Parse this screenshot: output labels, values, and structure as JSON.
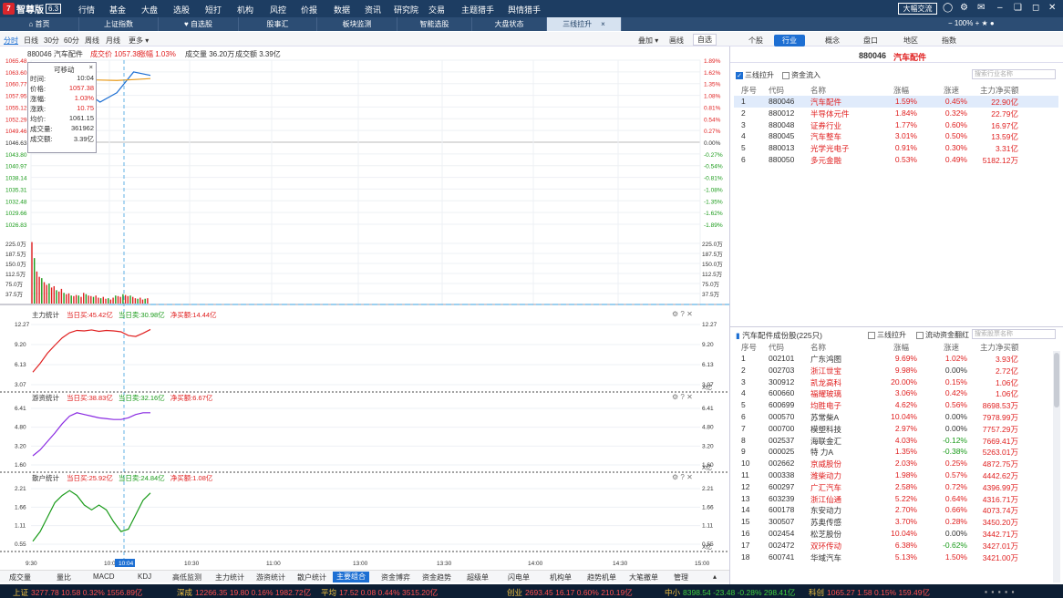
{
  "app": {
    "logo_mark": "7",
    "name": "智尊版",
    "version": "6.3"
  },
  "menu": [
    "行情",
    "基金",
    "大盘",
    "选股",
    "短打",
    "机构",
    "风控",
    "价报",
    "数据",
    "资讯",
    "研究院",
    "交易",
    "主题猎手",
    "舆情猎手"
  ],
  "menu_right": {
    "big_button": "大幅交流",
    "zoom": "100%"
  },
  "tabs": [
    {
      "label": "首页",
      "icon": "home-icon"
    },
    {
      "label": "上证指数"
    },
    {
      "label": "自选股",
      "icon": "heart-icon"
    },
    {
      "label": "股事汇"
    },
    {
      "label": "板块监测"
    },
    {
      "label": "智能选股"
    },
    {
      "label": "大盘状态"
    },
    {
      "label": "三线拉升",
      "active": true,
      "close": "×"
    }
  ],
  "toolbar": {
    "items": [
      "分时",
      "日线",
      "30分",
      "60分",
      "周线",
      "月线",
      "更多 ▾"
    ],
    "right": [
      "叠加 ▾",
      "画线",
      "自选"
    ]
  },
  "chart_header": {
    "code_name": "880046 汽车配件",
    "price": "成交价 1057.38",
    "change": "涨幅 1.03%",
    "volume": "成交量 36.20万",
    "amount": "成交额 3.39亿"
  },
  "price_axis_left": [
    "1065.48",
    "1063.60",
    "1060.77",
    "1057.95",
    "1055.12",
    "1052.29",
    "1049.46",
    "1046.63",
    "1043.80",
    "1040.97",
    "1038.14",
    "1035.31",
    "1032.48",
    "1029.66",
    "1026.83"
  ],
  "price_axis_right": [
    "1.89%",
    "1.62%",
    "1.35%",
    "1.08%",
    "0.81%",
    "0.54%",
    "0.27%",
    "0.00%",
    "-0.27%",
    "-0.54%",
    "-0.81%",
    "-1.08%",
    "-1.35%",
    "-1.62%",
    "-1.89%"
  ],
  "vol_axis": [
    "225.0万",
    "187.5万",
    "150.0万",
    "112.5万",
    "75.0万",
    "37.5万"
  ],
  "tooltip": {
    "title": "可移动",
    "close": "×",
    "rows": [
      [
        "时间:",
        "10:04"
      ],
      [
        "价格:",
        "1057.38"
      ],
      [
        "涨幅:",
        "1.03%"
      ],
      [
        "涨跌:",
        "10.75"
      ],
      [
        "均价:",
        "1061.15"
      ],
      [
        "成交量:",
        "361962"
      ],
      [
        "成交额:",
        "3.39亿"
      ]
    ]
  },
  "panels": [
    {
      "title": "主力统计",
      "buy": "当日买:45.42亿",
      "sell": "当日卖:30.98亿",
      "net": "净买额:14.44亿",
      "axis": [
        "12.27",
        "9.20",
        "6.13",
        "3.07"
      ],
      "unit": "X亿"
    },
    {
      "title": "游资统计",
      "buy": "当日买:38.83亿",
      "sell": "当日卖:32.16亿",
      "net": "净买额:6.67亿",
      "axis": [
        "6.41",
        "4.80",
        "3.20",
        "1.60"
      ],
      "unit": "X亿"
    },
    {
      "title": "散户统计",
      "buy": "当日买:25.92亿",
      "sell": "当日卖:24.84亿",
      "net": "净买额:1.08亿",
      "axis": [
        "2.21",
        "1.66",
        "1.11",
        "0.55"
      ],
      "unit": "X亿"
    }
  ],
  "time_axis": [
    "9:30",
    "10:00",
    "10:04",
    "10:30",
    "11:00",
    "13:00",
    "13:30",
    "14:00",
    "14:30",
    "15:00"
  ],
  "bottom_tabs": [
    "成交量",
    "量比",
    "MACD",
    "KDJ",
    "高低监测",
    "主力统计",
    "游资统计",
    "散户统计",
    "主要组合",
    "资金博弈",
    "资金趋势",
    "超级单",
    "闪电单",
    "机构单",
    "趋势机单",
    "大笔撤单",
    "管理"
  ],
  "bottom_active": "主要组合",
  "right_tabs": [
    "个股",
    "行业",
    "概念",
    "盘口",
    "地区",
    "指数"
  ],
  "right_active": "行业",
  "sector_title": {
    "code": "880046",
    "name": "汽车配件"
  },
  "sector_filter": {
    "opt1": "三线拉升",
    "opt2": "资金流入",
    "search": "搜索行业名称"
  },
  "sector_headers": [
    "序号",
    "代码",
    "名称",
    "涨幅",
    "涨速",
    "主力净买额"
  ],
  "sector_rows": [
    [
      "1",
      "880046",
      "汽车配件",
      "1.59%",
      "0.45%",
      "22.90亿"
    ],
    [
      "2",
      "880012",
      "半导体元件",
      "1.84%",
      "0.32%",
      "22.79亿"
    ],
    [
      "3",
      "880048",
      "证券行业",
      "1.77%",
      "0.60%",
      "16.97亿"
    ],
    [
      "4",
      "880045",
      "汽车整车",
      "3.01%",
      "0.50%",
      "13.59亿"
    ],
    [
      "5",
      "880013",
      "光学光电子",
      "0.91%",
      "0.30%",
      "3.31亿"
    ],
    [
      "6",
      "880050",
      "多元金融",
      "0.53%",
      "0.49%",
      "5182.12万"
    ]
  ],
  "stock_title": "汽车配件成份股(225只)",
  "stock_filter": {
    "opt1": "三线拉升",
    "opt2": "流动资金翻红",
    "search": "搜索股票名称"
  },
  "stock_headers": [
    "序号",
    "代码",
    "名称",
    "涨幅",
    "涨速",
    "主力净买额"
  ],
  "stock_rows": [
    [
      "1",
      "002101",
      "广东鸿图",
      "9.69%",
      "1.02%",
      "3.93亿"
    ],
    [
      "2",
      "002703",
      "浙江世宝",
      "9.98%",
      "0.00%",
      "2.72亿"
    ],
    [
      "3",
      "300912",
      "凯龙高科",
      "20.00%",
      "0.15%",
      "1.06亿"
    ],
    [
      "4",
      "600660",
      "福耀玻璃",
      "3.06%",
      "0.42%",
      "1.06亿"
    ],
    [
      "5",
      "600699",
      "均胜电子",
      "4.62%",
      "0.56%",
      "8698.53万"
    ],
    [
      "6",
      "000570",
      "苏常柴A",
      "10.04%",
      "0.00%",
      "7978.99万"
    ],
    [
      "7",
      "000700",
      "模塑科技",
      "2.97%",
      "0.00%",
      "7757.29万"
    ],
    [
      "8",
      "002537",
      "海联金汇",
      "4.03%",
      "-0.12%",
      "7669.41万"
    ],
    [
      "9",
      "000025",
      "特 力A",
      "1.35%",
      "-0.38%",
      "5263.01万"
    ],
    [
      "10",
      "002662",
      "京威股份",
      "2.03%",
      "0.25%",
      "4872.75万"
    ],
    [
      "11",
      "000338",
      "潍柴动力",
      "1.98%",
      "0.57%",
      "4442.62万"
    ],
    [
      "12",
      "600297",
      "广汇汽车",
      "2.58%",
      "0.72%",
      "4396.99万"
    ],
    [
      "13",
      "603239",
      "浙江仙通",
      "5.22%",
      "0.64%",
      "4316.71万"
    ],
    [
      "14",
      "600178",
      "东安动力",
      "2.70%",
      "0.66%",
      "4073.74万"
    ],
    [
      "15",
      "300507",
      "苏奥传感",
      "3.70%",
      "0.28%",
      "3450.20万"
    ],
    [
      "16",
      "002454",
      "松芝股份",
      "10.04%",
      "0.00%",
      "3442.71万"
    ],
    [
      "17",
      "002472",
      "双环传动",
      "6.38%",
      "-0.62%",
      "3427.01万"
    ],
    [
      "18",
      "600741",
      "华域汽车",
      "5.13%",
      "1.50%",
      "3421.00万"
    ]
  ],
  "status": [
    {
      "name": "上证",
      "vals": "3277.78 10.58 0.32% 1556.89亿"
    },
    {
      "name": "深成",
      "vals": "12266.35 19.80 0.16% 1982.72亿"
    },
    {
      "name": "平均",
      "vals": "17.52 0.08 0.44% 3515.20亿"
    },
    {
      "name": "创业",
      "vals": "2693.45 16.17 0.60% 210.19亿"
    },
    {
      "name": "中小",
      "vals": "8398.54 -23.48 -0.28% 298.41亿"
    },
    {
      "name": "科创",
      "vals": "1065.27 1.58 0.15% 159.49亿"
    }
  ],
  "colors": {
    "up": "#e02020",
    "down": "#1a9b1a",
    "accent": "#1d6fd3",
    "header": "#1d3d62"
  },
  "chart_data": {
    "type": "line",
    "price": {
      "x": [
        "9:30",
        "9:35",
        "9:40",
        "9:45",
        "9:50",
        "9:55",
        "10:00",
        "10:04"
      ],
      "values": [
        1062.5,
        1064.8,
        1060.9,
        1058.4,
        1055.6,
        1057.8,
        1062.7,
        1061.9
      ],
      "avg": [
        1060.1,
        1060.8,
        1060.9,
        1060.9,
        1060.8,
        1060.7,
        1060.9,
        1061.15
      ]
    },
    "volume": [
      230,
      170,
      120,
      100,
      95,
      80,
      70,
      75,
      60,
      65,
      50,
      45,
      55,
      40,
      35,
      38,
      30,
      28,
      32,
      30,
      25,
      40,
      35,
      30,
      28,
      25,
      30,
      22,
      20,
      25,
      18,
      20,
      15,
      22,
      30,
      28,
      25,
      35,
      32,
      28,
      30,
      25,
      20,
      18,
      22,
      15,
      18,
      20
    ],
    "main": [
      3.1,
      5.0,
      7.2,
      8.9,
      10.5,
      11.6,
      12.1,
      12.0,
      12.2,
      11.9,
      12.1,
      12.0,
      11.8,
      11.0,
      10.8,
      11.5,
      12.3
    ],
    "hot": [
      1.3,
      2.0,
      3.0,
      4.0,
      5.1,
      6.0,
      6.4,
      6.2,
      6.0,
      5.8,
      5.7,
      5.6,
      5.6,
      5.8,
      6.2,
      6.4,
      6.4
    ],
    "retail": [
      0.2,
      0.6,
      1.2,
      1.8,
      2.1,
      2.3,
      2.1,
      1.7,
      1.5,
      1.7,
      1.5,
      1.0,
      0.6,
      0.7,
      1.3,
      1.9,
      2.2
    ]
  }
}
